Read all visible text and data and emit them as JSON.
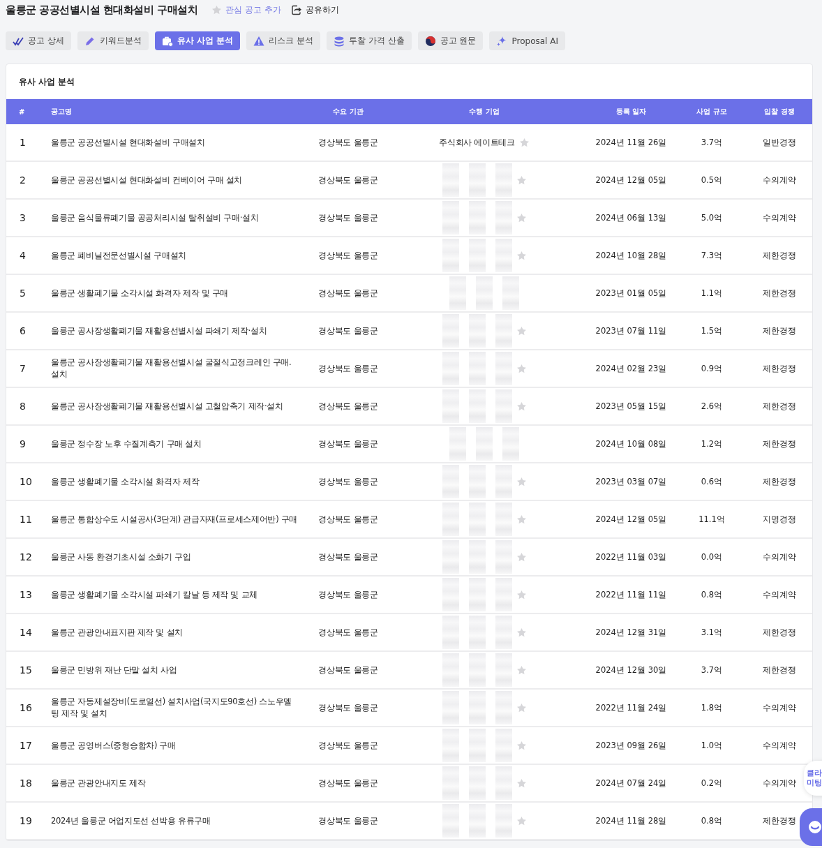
{
  "title": "울릉군 공공선별시설 현대화설비 구매설치",
  "header_actions": [
    {
      "kind": "watch",
      "label": "관심 공고 추가"
    },
    {
      "kind": "share",
      "label": "공유하기"
    }
  ],
  "tabs": [
    {
      "label": "공고 상세",
      "selected": false
    },
    {
      "label": "키워드분석",
      "selected": false
    },
    {
      "label": "유사 사업 분석",
      "selected": true
    },
    {
      "label": "리스크 분석",
      "selected": false
    },
    {
      "label": "투찰 가격 산출",
      "selected": false
    },
    {
      "label": "공고 원문",
      "selected": false
    },
    {
      "label": "Proposal AI",
      "selected": false
    }
  ],
  "panel": {
    "title": "유사 사업 분석",
    "table": {
      "columns": [
        "#",
        "공고명",
        "수요 기관",
        "수행 기업",
        "등록 일자",
        "사업 규모",
        "입찰 경쟁"
      ],
      "rows": [
        {
          "no": "1",
          "name": "울릉군 공공선별시설 현대화설비 구매설치",
          "agency": "경상북도 울릉군",
          "company": "주식회사 에이트테크",
          "redacted": false,
          "star": true,
          "date": "2024년 11월 26일",
          "size": "3.7억",
          "bid": "일반경쟁"
        },
        {
          "no": "2",
          "name": "울릉군 공공선별시설 현대화설비 컨베이어 구매 설치",
          "agency": "경상북도 울릉군",
          "redacted": true,
          "star": true,
          "date": "2024년 12월 05일",
          "size": "0.5억",
          "bid": "수의계약"
        },
        {
          "no": "3",
          "name": "울릉군 음식물류폐기물 공공처리시설 탈취설비 구매·설치",
          "agency": "경상북도 울릉군",
          "redacted": true,
          "star": true,
          "date": "2024년 06월 13일",
          "size": "5.0억",
          "bid": "수의계약"
        },
        {
          "no": "4",
          "name": "울릉군 폐비닐전문선별시설 구매설치",
          "agency": "경상북도 울릉군",
          "redacted": true,
          "star": true,
          "date": "2024년 10월 28일",
          "size": "7.3억",
          "bid": "제한경쟁"
        },
        {
          "no": "5",
          "name": "울릉군 생활폐기물 소각시설 화격자 제작 및 구매",
          "agency": "경상북도 울릉군",
          "redacted": true,
          "star": false,
          "date": "2023년 01월 05일",
          "size": "1.1억",
          "bid": "제한경쟁"
        },
        {
          "no": "6",
          "name": "울릉군 공사장생활폐기물 재활용선별시설 파쇄기 제작·설치",
          "agency": "경상북도 울릉군",
          "redacted": true,
          "star": true,
          "date": "2023년 07월 11일",
          "size": "1.5억",
          "bid": "제한경쟁"
        },
        {
          "no": "7",
          "name": "울릉군 공사장생활폐기물 재활용선별시설 굴절식고정크레인 구매.설치",
          "agency": "경상북도 울릉군",
          "redacted": true,
          "star": true,
          "date": "2024년 02월 23일",
          "size": "0.9억",
          "bid": "제한경쟁"
        },
        {
          "no": "8",
          "name": "울릉군 공사장생활폐기물 재활용선별시설 고철압축기 제작·설치",
          "agency": "경상북도 울릉군",
          "redacted": true,
          "star": true,
          "date": "2023년 05월 15일",
          "size": "2.6억",
          "bid": "제한경쟁"
        },
        {
          "no": "9",
          "name": "울릉군 정수장 노후 수질계측기 구매 설치",
          "agency": "경상북도 울릉군",
          "redacted": true,
          "star": false,
          "date": "2024년 10월 08일",
          "size": "1.2억",
          "bid": "제한경쟁"
        },
        {
          "no": "10",
          "name": "울릉군 생활폐기물 소각시설 화격자 제작",
          "agency": "경상북도 울릉군",
          "redacted": true,
          "star": true,
          "date": "2023년 03월 07일",
          "size": "0.6억",
          "bid": "제한경쟁"
        },
        {
          "no": "11",
          "name": "울릉군 통합상수도 시설공사(3단계) 관급자재(프로세스제어반) 구매",
          "agency": "경상북도 울릉군",
          "redacted": true,
          "star": true,
          "date": "2024년 12월 05일",
          "size": "11.1억",
          "bid": "지명경쟁"
        },
        {
          "no": "12",
          "name": "울릉군 사동 환경기초시설 소화기 구입",
          "agency": "경상북도 울릉군",
          "redacted": true,
          "star": true,
          "date": "2022년 11월 03일",
          "size": "0.0억",
          "bid": "수의계약"
        },
        {
          "no": "13",
          "name": "울릉군 생활폐기물 소각시설 파쇄기 칼날 등 제작 및 교체",
          "agency": "경상북도 울릉군",
          "redacted": true,
          "star": true,
          "date": "2022년 11월 11일",
          "size": "0.8억",
          "bid": "수의계약"
        },
        {
          "no": "14",
          "name": "울릉군 관광안내표지판 제작 및 설치",
          "agency": "경상북도 울릉군",
          "redacted": true,
          "star": true,
          "date": "2024년 12월 31일",
          "size": "3.1억",
          "bid": "제한경쟁"
        },
        {
          "no": "15",
          "name": "울릉군 민방위 재난 단말 설치 사업",
          "agency": "경상북도 울릉군",
          "redacted": true,
          "star": true,
          "date": "2024년 12월 30일",
          "size": "3.7억",
          "bid": "제한경쟁"
        },
        {
          "no": "16",
          "name": "울릉군 자동제설장비(도로열선) 설치사업(국지도90호선) 스노우멜팅 제작 및 설치",
          "agency": "경상북도 울릉군",
          "redacted": true,
          "star": true,
          "date": "2022년 11월 24일",
          "size": "1.8억",
          "bid": "수의계약"
        },
        {
          "no": "17",
          "name": "울릉군 공영버스(중형승합차) 구매",
          "agency": "경상북도 울릉군",
          "redacted": true,
          "star": true,
          "date": "2023년 09월 26일",
          "size": "1.0억",
          "bid": "수의계약"
        },
        {
          "no": "18",
          "name": "울릉군 관광안내지도 제작",
          "agency": "경상북도 울릉군",
          "redacted": true,
          "star": true,
          "date": "2024년 07월 24일",
          "size": "0.2억",
          "bid": "수의계약"
        },
        {
          "no": "19",
          "name": "2024년 울릉군 어업지도선 선박용 유류구매",
          "agency": "경상북도 울릉군",
          "redacted": true,
          "star": true,
          "date": "2024년 11월 28일",
          "size": "0.8억",
          "bid": "제한경쟁"
        }
      ]
    }
  },
  "floating": {
    "label_lines": [
      "클라",
      "미팅"
    ]
  }
}
